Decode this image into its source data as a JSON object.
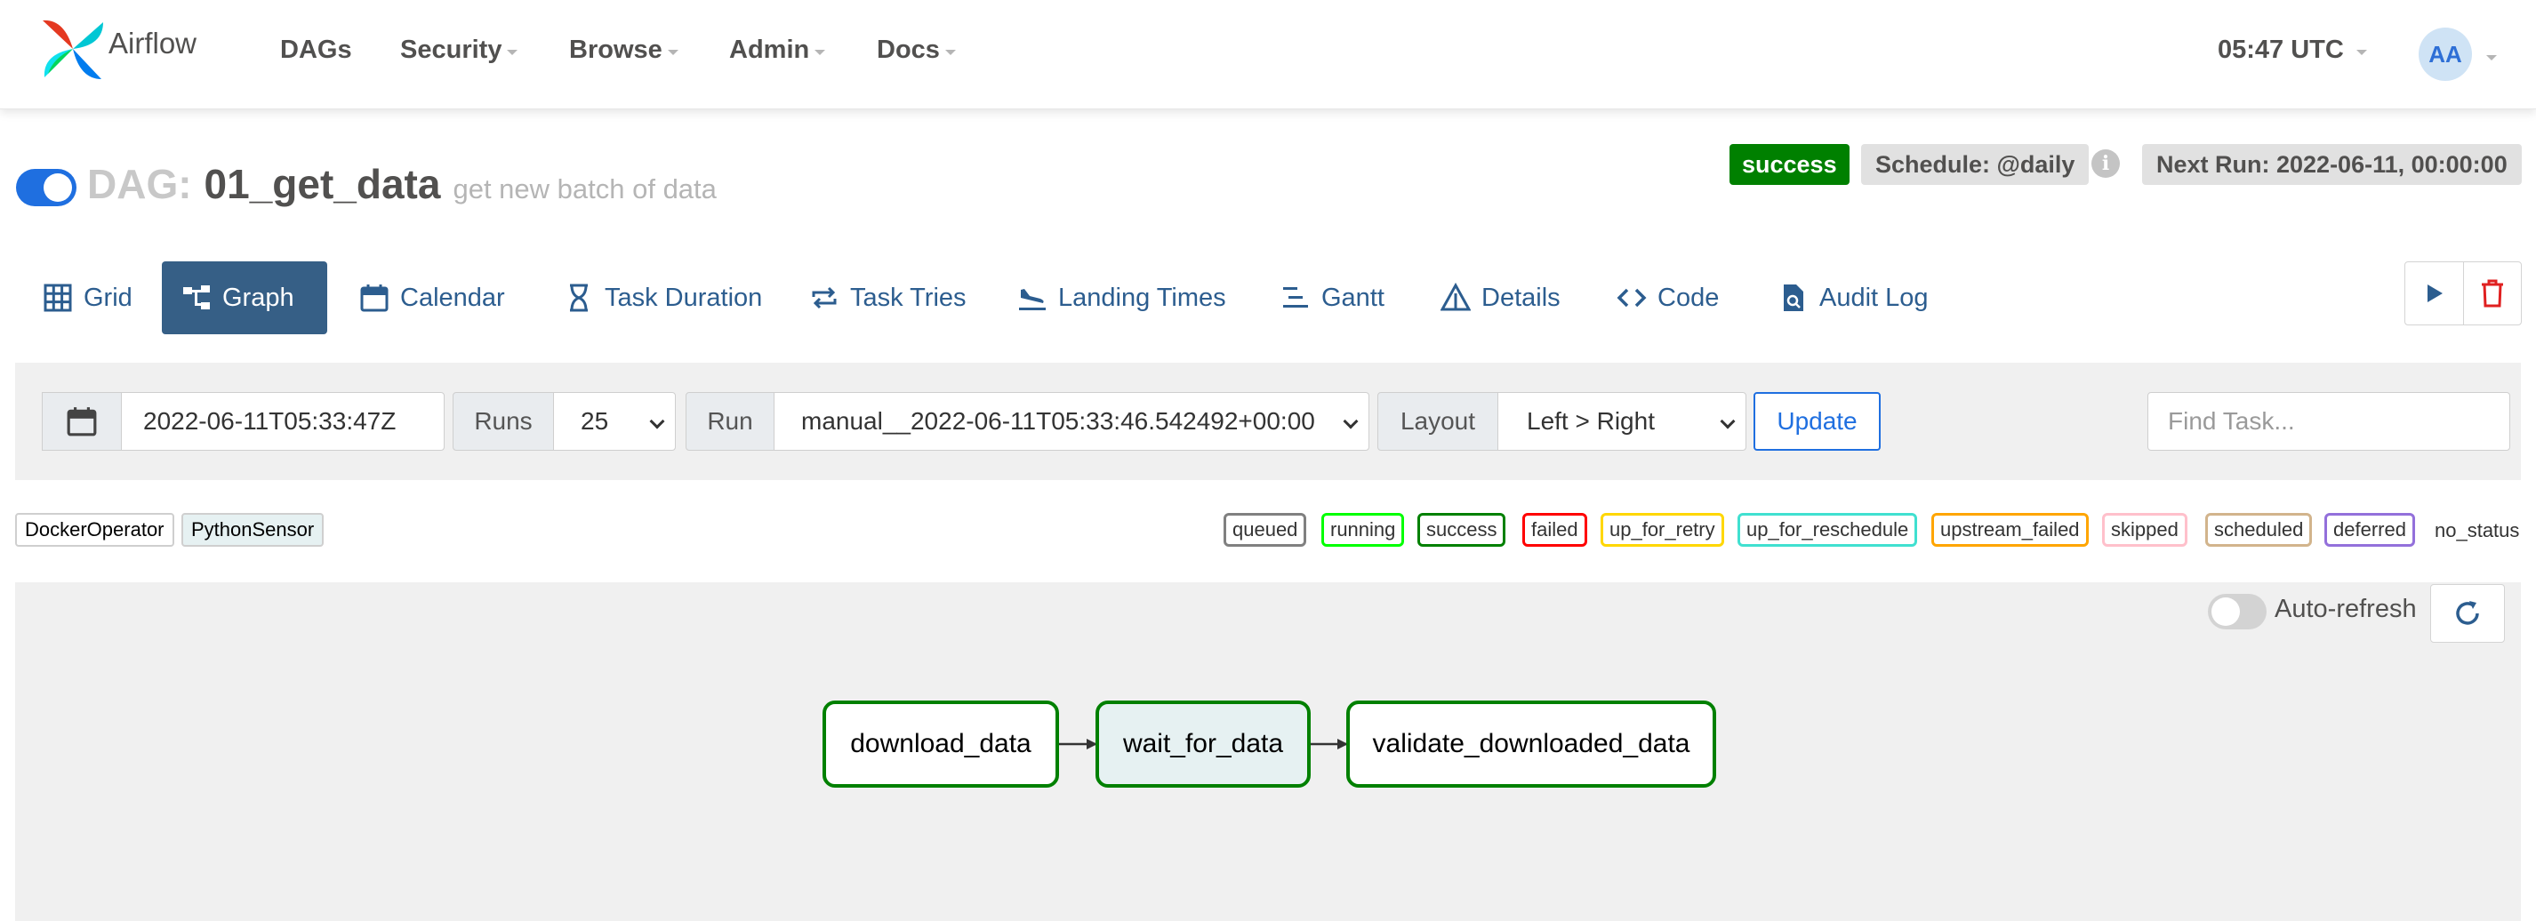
{
  "navbar": {
    "brand": "Airflow",
    "items": [
      {
        "label": "DAGs",
        "dropdown": false
      },
      {
        "label": "Security",
        "dropdown": true
      },
      {
        "label": "Browse",
        "dropdown": true
      },
      {
        "label": "Admin",
        "dropdown": true
      },
      {
        "label": "Docs",
        "dropdown": true
      }
    ],
    "clock": "05:47 UTC",
    "avatar_initials": "AA"
  },
  "dag": {
    "prefix": "DAG:",
    "id": "01_get_data",
    "description": "get new batch of data",
    "paused": false,
    "status": "success",
    "schedule": "Schedule: @daily",
    "info_icon": "i",
    "next_run": "Next Run: 2022-06-11, 00:00:00"
  },
  "tabs": [
    {
      "label": "Grid",
      "icon": "grid-icon",
      "active": false
    },
    {
      "label": "Graph",
      "icon": "graph-icon",
      "active": true
    },
    {
      "label": "Calendar",
      "icon": "calendar-icon",
      "active": false
    },
    {
      "label": "Task Duration",
      "icon": "hourglass-icon",
      "active": false
    },
    {
      "label": "Task Tries",
      "icon": "retry-icon",
      "active": false
    },
    {
      "label": "Landing Times",
      "icon": "plane-landing-icon",
      "active": false
    },
    {
      "label": "Gantt",
      "icon": "gantt-icon",
      "active": false
    },
    {
      "label": "Details",
      "icon": "warning-triangle-icon",
      "active": false
    },
    {
      "label": "Code",
      "icon": "code-icon",
      "active": false
    },
    {
      "label": "Audit Log",
      "icon": "file-search-icon",
      "active": false
    }
  ],
  "actions": {
    "trigger_icon": "play-icon",
    "delete_icon": "trash-icon"
  },
  "filters": {
    "base_date": "2022-06-11T05:33:47Z",
    "runs_label": "Runs",
    "runs_value": "25",
    "run_label": "Run",
    "run_value": "manual__2022-06-11T05:33:46.542492+00:00",
    "layout_label": "Layout",
    "layout_value": "Left > Right",
    "update_label": "Update",
    "find_task_placeholder": "Find Task..."
  },
  "operators": [
    {
      "label": "DockerOperator",
      "bg": "#ffffff"
    },
    {
      "label": "PythonSensor",
      "bg": "#e6f1f2"
    }
  ],
  "states": [
    {
      "label": "queued",
      "color": "#808080"
    },
    {
      "label": "running",
      "color": "#00ff00"
    },
    {
      "label": "success",
      "color": "#008000"
    },
    {
      "label": "failed",
      "color": "#ff0000"
    },
    {
      "label": "up_for_retry",
      "color": "#ffd700"
    },
    {
      "label": "up_for_reschedule",
      "color": "#40e0d0"
    },
    {
      "label": "upstream_failed",
      "color": "#ffa500"
    },
    {
      "label": "skipped",
      "color": "#ffc0cb"
    },
    {
      "label": "scheduled",
      "color": "#d2b48c"
    },
    {
      "label": "deferred",
      "color": "#9370db"
    }
  ],
  "no_status_label": "no_status",
  "graph": {
    "auto_refresh_label": "Auto-refresh",
    "auto_refresh_on": false,
    "tasks": [
      {
        "id": "download_data",
        "state": "success",
        "operator_bg": "#ffffff"
      },
      {
        "id": "wait_for_data",
        "state": "success",
        "operator_bg": "#e6f1f2"
      },
      {
        "id": "validate_downloaded_data",
        "state": "success",
        "operator_bg": "#ffffff"
      }
    ]
  }
}
